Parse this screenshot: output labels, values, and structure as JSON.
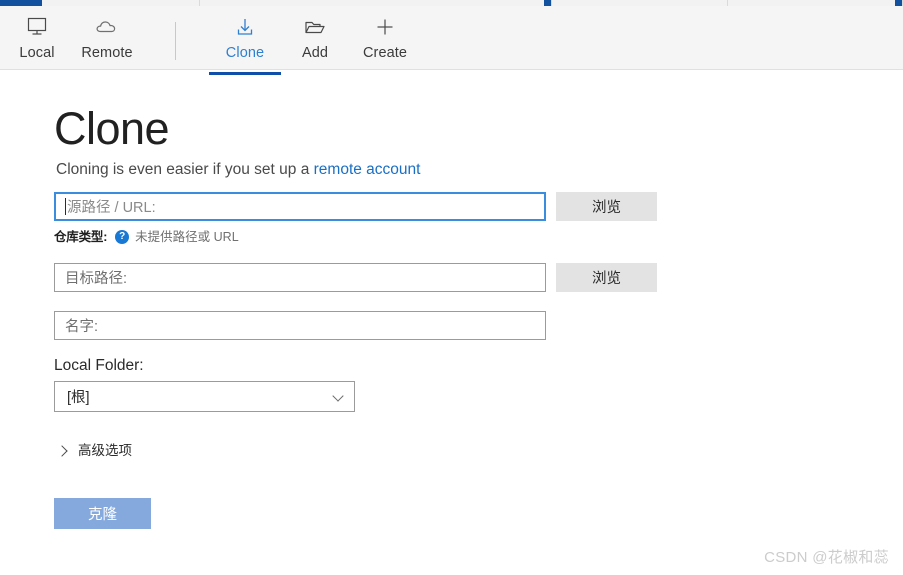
{
  "window": {
    "tabstrip_visible": true,
    "tabs_partial": [
      "",
      "",
      "",
      "",
      ""
    ]
  },
  "toolbar": {
    "items": [
      {
        "label": "Local",
        "icon": "monitor-icon",
        "active": false
      },
      {
        "label": "Remote",
        "icon": "cloud-icon",
        "active": false
      },
      {
        "label": "Clone",
        "icon": "download-arrow-icon",
        "active": true
      },
      {
        "label": "Add",
        "icon": "folder-open-icon",
        "active": false
      },
      {
        "label": "Create",
        "icon": "plus-icon",
        "active": false
      }
    ]
  },
  "page": {
    "title": "Clone",
    "subtitle_prefix": "Cloning is even easier if you set up a ",
    "subtitle_link": "remote account"
  },
  "form": {
    "source": {
      "placeholder": "源路径 / URL:",
      "value": "",
      "focused": true,
      "browse_label": "浏览"
    },
    "repo_type": {
      "label": "仓库类型:",
      "help_icon": "question-mark-icon",
      "message": "未提供路径或 URL"
    },
    "destination": {
      "placeholder": "目标路径:",
      "value": "",
      "browse_label": "浏览"
    },
    "name": {
      "placeholder": "名字:",
      "value": ""
    },
    "local_folder": {
      "label": "Local Folder:",
      "selected": "[根]",
      "options": [
        "[根]"
      ]
    },
    "advanced": {
      "label": "高级选项",
      "expanded": false,
      "icon": "chevron-right-icon"
    },
    "submit": {
      "label": "克隆",
      "enabled": false
    }
  },
  "watermark": {
    "text": "CSDN @花椒和蕊"
  },
  "colors": {
    "accent_blue": "#0f4faa",
    "tab_active_text": "#2f7fd1",
    "link_blue": "#1a6fc4",
    "focus_border": "#3a8ddd",
    "help_icon_bg": "#1878d4",
    "primary_button_disabled": "#85a9dd",
    "toolbar_bg": "#f5f5f5",
    "browse_button_bg": "#e3e3e3"
  }
}
